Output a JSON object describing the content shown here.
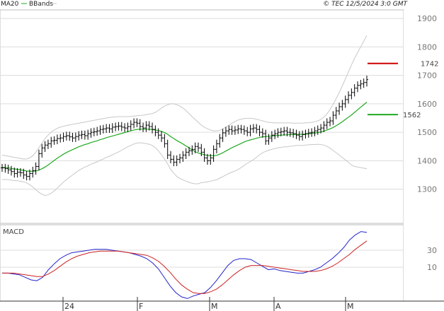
{
  "header": {
    "legend_ma20": "MA20",
    "legend_bbands": "BBands",
    "source": "© TEC 12/5/2024 3:0 GMT"
  },
  "colors": {
    "bars": "#000000",
    "ma20": "#22aa22",
    "bbands": "#c8c8c8",
    "grid": "#dcdcdc",
    "red_marker": "#cc0000",
    "green_marker": "#22aa22",
    "macd_blue": "#2222cc",
    "macd_red": "#cc2222"
  },
  "chart_data": [
    {
      "type": "ohlc",
      "panel": "price",
      "yticks": [
        1300,
        1400,
        1500,
        1600,
        1700,
        1800,
        1900
      ],
      "ylim": [
        1180,
        1930
      ],
      "xlabels": [
        "24",
        "F",
        "M",
        "A",
        "M"
      ],
      "markers": [
        {
          "label": "1742",
          "value": 1742,
          "color": "#cc0000"
        },
        {
          "label": "1562",
          "value": 1562,
          "color": "#22aa22"
        }
      ],
      "close": [
        1375,
        1372,
        1368,
        1362,
        1355,
        1360,
        1358,
        1350,
        1345,
        1355,
        1365,
        1380,
        1425,
        1445,
        1455,
        1460,
        1470,
        1472,
        1478,
        1480,
        1485,
        1488,
        1484,
        1480,
        1485,
        1490,
        1492,
        1488,
        1495,
        1500,
        1502,
        1505,
        1510,
        1512,
        1515,
        1512,
        1518,
        1520,
        1522,
        1518,
        1515,
        1520,
        1528,
        1535,
        1532,
        1520,
        1515,
        1525,
        1520,
        1510,
        1500,
        1490,
        1480,
        1460,
        1420,
        1405,
        1395,
        1405,
        1410,
        1420,
        1430,
        1435,
        1440,
        1450,
        1445,
        1430,
        1410,
        1400,
        1410,
        1440,
        1460,
        1480,
        1498,
        1505,
        1510,
        1505,
        1508,
        1512,
        1510,
        1505,
        1500,
        1512,
        1515,
        1510,
        1500,
        1495,
        1470,
        1480,
        1490,
        1495,
        1500,
        1502,
        1505,
        1500,
        1498,
        1495,
        1490,
        1485,
        1492,
        1495,
        1498,
        1500,
        1505,
        1510,
        1515,
        1525,
        1535,
        1540,
        1560,
        1575,
        1590,
        1600,
        1615,
        1630,
        1640,
        1655,
        1665,
        1670,
        1675,
        1685
      ],
      "ma20": [
        1377,
        1376,
        1375,
        1373,
        1371,
        1370,
        1368,
        1366,
        1364,
        1363,
        1363,
        1364,
        1367,
        1372,
        1378,
        1385,
        1393,
        1401,
        1409,
        1416,
        1423,
        1429,
        1434,
        1439,
        1444,
        1449,
        1453,
        1457,
        1460,
        1464,
        1467,
        1470,
        1474,
        1477,
        1481,
        1484,
        1487,
        1490,
        1493,
        1496,
        1499,
        1502,
        1505,
        1508,
        1510,
        1511,
        1511,
        1511,
        1511,
        1510,
        1508,
        1506,
        1503,
        1499,
        1493,
        1485,
        1478,
        1471,
        1465,
        1459,
        1452,
        1445,
        1438,
        1432,
        1427,
        1424,
        1421,
        1419,
        1418,
        1418,
        1419,
        1423,
        1428,
        1434,
        1440,
        1446,
        1451,
        1456,
        1461,
        1466,
        1470,
        1473,
        1476,
        1479,
        1482,
        1484,
        1485,
        1486,
        1487,
        1488,
        1489,
        1490,
        1491,
        1491,
        1492,
        1492,
        1493,
        1493,
        1493,
        1494,
        1495,
        1496,
        1497,
        1499,
        1501,
        1504,
        1508,
        1512,
        1517,
        1523,
        1530,
        1537,
        1545,
        1553,
        1561,
        1570,
        1579,
        1588,
        1597,
        1606
      ],
      "bb_upper": [
        1420,
        1418,
        1416,
        1414,
        1412,
        1410,
        1408,
        1406,
        1406,
        1410,
        1418,
        1430,
        1445,
        1462,
        1478,
        1490,
        1500,
        1508,
        1514,
        1518,
        1521,
        1524,
        1526,
        1528,
        1530,
        1532,
        1534,
        1536,
        1538,
        1540,
        1542,
        1544,
        1546,
        1548,
        1550,
        1552,
        1553,
        1554,
        1555,
        1555,
        1555,
        1555,
        1556,
        1557,
        1558,
        1559,
        1560,
        1562,
        1564,
        1566,
        1570,
        1577,
        1585,
        1592,
        1597,
        1600,
        1600,
        1597,
        1592,
        1585,
        1576,
        1566,
        1555,
        1545,
        1535,
        1525,
        1518,
        1512,
        1508,
        1505,
        1505,
        1507,
        1512,
        1518,
        1525,
        1532,
        1538,
        1543,
        1546,
        1548,
        1549,
        1549,
        1548,
        1546,
        1543,
        1540,
        1537,
        1535,
        1534,
        1533,
        1533,
        1533,
        1533,
        1533,
        1533,
        1532,
        1532,
        1532,
        1532,
        1533,
        1534,
        1535,
        1537,
        1540,
        1545,
        1553,
        1565,
        1580,
        1598,
        1618,
        1640,
        1663,
        1687,
        1712,
        1737,
        1760,
        1780,
        1800,
        1820,
        1840
      ],
      "bb_lower": [
        1334,
        1334,
        1334,
        1332,
        1330,
        1330,
        1328,
        1326,
        1322,
        1316,
        1308,
        1298,
        1289,
        1282,
        1278,
        1280,
        1286,
        1294,
        1304,
        1314,
        1325,
        1334,
        1342,
        1350,
        1358,
        1366,
        1372,
        1378,
        1382,
        1388,
        1392,
        1396,
        1402,
        1406,
        1412,
        1416,
        1421,
        1426,
        1431,
        1437,
        1443,
        1449,
        1454,
        1459,
        1462,
        1463,
        1462,
        1460,
        1458,
        1454,
        1446,
        1435,
        1421,
        1406,
        1389,
        1370,
        1356,
        1345,
        1338,
        1333,
        1328,
        1324,
        1321,
        1319,
        1319,
        1323,
        1324,
        1326,
        1328,
        1331,
        1333,
        1339,
        1344,
        1350,
        1355,
        1360,
        1364,
        1369,
        1376,
        1384,
        1391,
        1397,
        1404,
        1412,
        1421,
        1428,
        1433,
        1437,
        1440,
        1443,
        1445,
        1447,
        1449,
        1449,
        1451,
        1452,
        1454,
        1454,
        1454,
        1455,
        1456,
        1457,
        1457,
        1458,
        1457,
        1455,
        1451,
        1444,
        1436,
        1428,
        1420,
        1411,
        1403,
        1394,
        1385,
        1380,
        1378,
        1376,
        1374,
        1372
      ]
    },
    {
      "type": "line",
      "panel": "macd",
      "title": "MACD",
      "yticks": [
        10,
        30
      ],
      "ylim": [
        -30,
        60
      ],
      "series": [
        {
          "values": [
            3,
            3,
            2,
            1,
            -2,
            -5,
            -6,
            -2,
            7,
            14,
            20,
            24,
            27,
            28,
            29,
            30,
            31,
            31,
            31,
            30,
            29,
            28,
            27,
            25,
            23,
            20,
            15,
            8,
            -2,
            -12,
            -20,
            -25,
            -27,
            -24,
            -22,
            -20,
            -14,
            -6,
            3,
            12,
            18,
            20,
            20,
            19,
            15,
            11,
            7,
            8,
            6,
            5,
            4,
            3,
            3,
            5,
            7,
            10,
            15,
            20,
            26,
            33,
            42,
            48,
            52,
            51
          ]
        },
        {
          "values": [
            3,
            3,
            3,
            2,
            1,
            0,
            -1,
            -1,
            2,
            6,
            11,
            16,
            20,
            23,
            25,
            27,
            28,
            29,
            29,
            29,
            29,
            28,
            27,
            26,
            25,
            24,
            21,
            17,
            11,
            4,
            -4,
            -11,
            -16,
            -20,
            -21,
            -21,
            -19,
            -16,
            -11,
            -5,
            1,
            6,
            10,
            12,
            12,
            12,
            11,
            10,
            9,
            8,
            7,
            6,
            5,
            5,
            5,
            6,
            8,
            11,
            15,
            20,
            25,
            31,
            36,
            41
          ]
        }
      ]
    }
  ]
}
